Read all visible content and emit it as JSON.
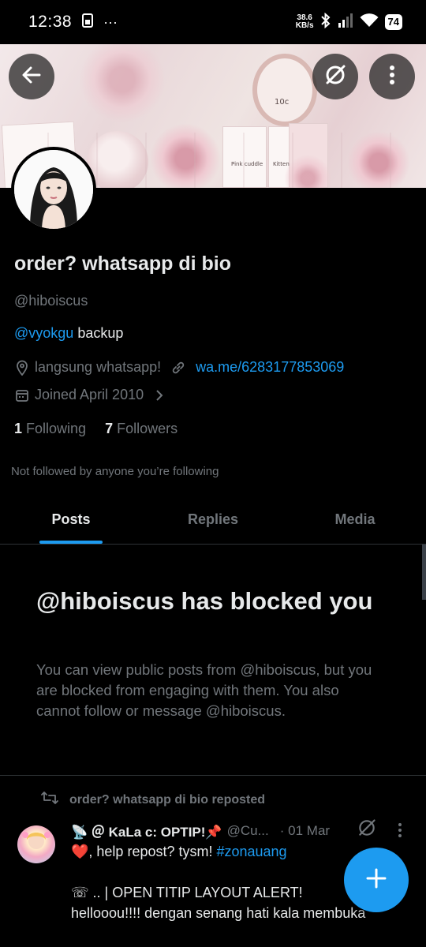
{
  "status_bar": {
    "time": "12:38",
    "dots": "···",
    "speed_value": "38.6",
    "speed_unit": "KB/s",
    "battery": "74"
  },
  "banner": {
    "label_left": "Pink cuddle",
    "label_right": "Kitten",
    "label_number": "10c"
  },
  "header": {
    "back_icon": "arrow-left-icon",
    "grok_icon": "slashed-circle-icon",
    "more_icon": "vertical-dots-icon"
  },
  "profile": {
    "display_name": "order? whatsapp di bio",
    "handle": "@hiboiscus",
    "bio_mention": "@vyokgu",
    "bio_text": " backup",
    "location": "langsung whatsapp!",
    "website": "wa.me/6283177853069",
    "joined": "Joined April 2010",
    "following_count": "1",
    "following_label": "Following",
    "followers_count": "7",
    "followers_label": "Followers",
    "not_followed": "Not followed by anyone you’re following"
  },
  "tabs": [
    {
      "label": "Posts",
      "active": true
    },
    {
      "label": "Replies",
      "active": false
    },
    {
      "label": "Media",
      "active": false
    }
  ],
  "blocked": {
    "title": "@hiboiscus has blocked you",
    "body": "You can view public posts from @hiboiscus, but you are blocked from engaging with them. You also cannot follow or message @hiboiscus."
  },
  "post": {
    "repost_label": "order? whatsapp di bio reposted",
    "author_name": "📡 ＠ KaLa c: OPTIP!📌",
    "author_handle": "@Cu...",
    "date": "· 01 Mar",
    "line1_prefix": "❤️, help repost? tysm! ",
    "hashtag": "#zonauang",
    "body": "☏ .. | OPEN TITIP LAYOUT ALERT!\nhellooou!!!! dengan senang hati kala membuka"
  },
  "colors": {
    "accent": "#1d9bf0",
    "background": "#000000",
    "muted": "#71767b",
    "text": "#e7e9ea"
  }
}
